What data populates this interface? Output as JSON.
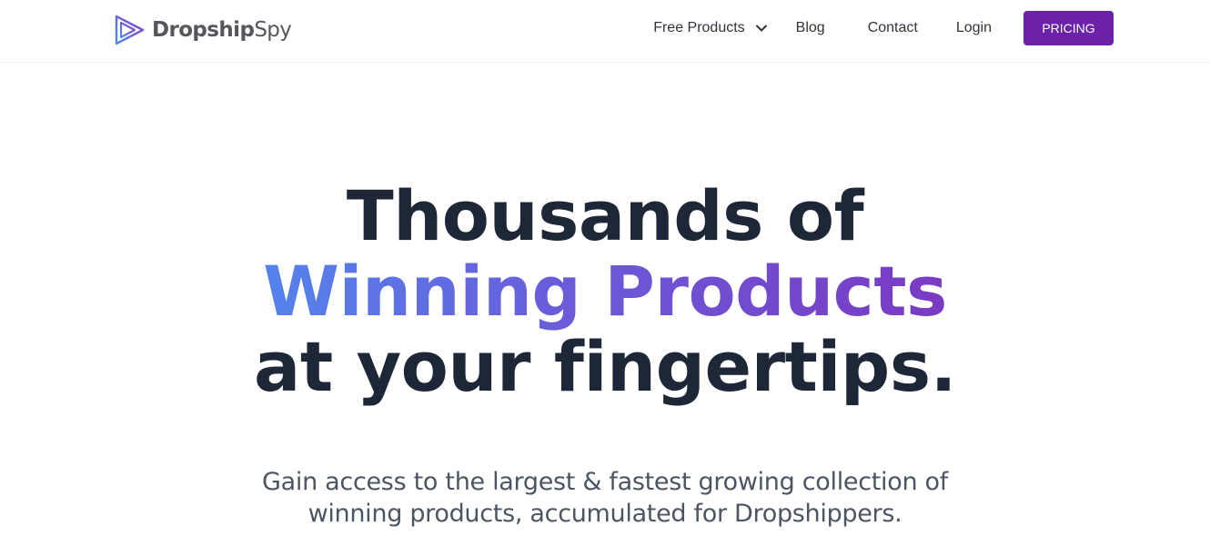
{
  "header": {
    "brand": {
      "name_part1": "Dropship",
      "name_part2": "Spy",
      "logo_icon": "play-triangle-logo-icon"
    },
    "nav": {
      "free_products": "Free Products",
      "blog": "Blog",
      "contact": "Contact",
      "login": "Login",
      "pricing": "PRICING"
    }
  },
  "hero": {
    "headline_line1": "Thousands of",
    "headline_line2": "Winning Products",
    "headline_line3": "at your fingertips.",
    "subtext_line1": "Gain access to the largest & fastest growing collection of",
    "subtext_line2": "winning products, accumulated for Dropshippers."
  },
  "colors": {
    "primary_button": "#6b21a8",
    "headline_dark": "#1e2738",
    "accent_gradient_start": "#5483ec",
    "accent_gradient_end": "#7a3ac2",
    "body_text": "#4b5563"
  }
}
